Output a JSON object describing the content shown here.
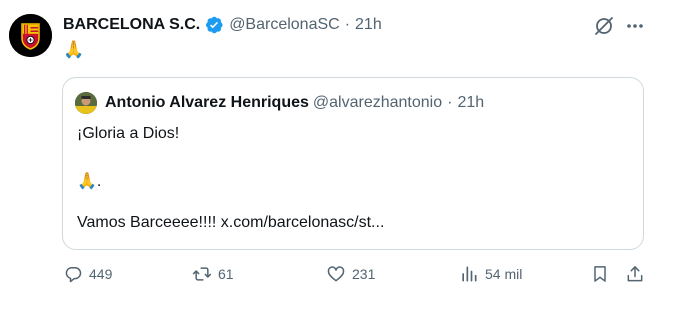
{
  "post": {
    "display_name": "BARCELONA S.C.",
    "handle": "@BarcelonaSC",
    "separator": "·",
    "time": "21h",
    "text": "🙏"
  },
  "quote": {
    "display_name": "Antonio Alvarez Henriques",
    "handle": "@alvarezhantonio",
    "separator": "·",
    "time": "21h",
    "line1": "¡Gloria a Dios!",
    "line2": "🙏.",
    "line3": "Vamos Barceeee!!!! x.com/barcelonasc/st..."
  },
  "actions": {
    "replies": "449",
    "reposts": "61",
    "likes": "231",
    "views": "54 mil"
  },
  "colors": {
    "text": "#0f1419",
    "secondary": "#536471",
    "verified": "#1d9bf0",
    "border": "#cfd9de",
    "crest_yellow": "#f5c400",
    "crest_red": "#c8102e"
  },
  "icons": {
    "verified": "verified-badge-icon",
    "grok": "grok-icon",
    "more": "more-icon",
    "reply": "reply-icon",
    "repost": "repost-icon",
    "like": "like-icon",
    "views": "views-icon",
    "bookmark": "bookmark-icon",
    "share": "share-icon"
  }
}
